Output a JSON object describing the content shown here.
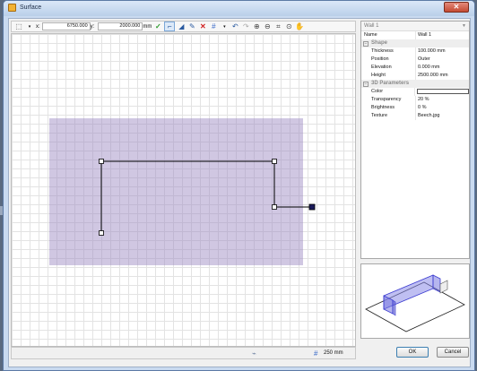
{
  "window": {
    "title": "Surface",
    "close_label": "✕"
  },
  "toolbar": {
    "x_label": "x:",
    "x_value": "6750.000",
    "y_label": "y:",
    "y_value": "2000.000",
    "unit": "mm",
    "icons": [
      "select-tool-icon",
      "dropdown-arrow-icon",
      "checkmark-icon",
      "draw-wall-icon",
      "paint-icon",
      "pen-icon",
      "delete-icon",
      "grid-icon",
      "undo-icon",
      "redo-icon",
      "zoom-in-icon",
      "zoom-out-icon",
      "zoom-fit-icon",
      "zoom-window-icon",
      "pan-hand-icon"
    ]
  },
  "properties": {
    "header": "Wall 1",
    "rows_top": [
      {
        "key": "Name",
        "value": "Wall 1"
      }
    ],
    "shape_label": "Shape",
    "shape": [
      {
        "key": "Thickness",
        "value": "100.000 mm"
      },
      {
        "key": "Position",
        "value": "Outer"
      },
      {
        "key": "Elevation",
        "value": "0.000 mm"
      },
      {
        "key": "Height",
        "value": "2500.000 mm"
      }
    ],
    "params_label": "3D Parameters",
    "params": [
      {
        "key": "Color",
        "value": ""
      },
      {
        "key": "Transparency",
        "value": "20 %"
      },
      {
        "key": "Brightness",
        "value": "0 %"
      },
      {
        "key": "Texture",
        "value": "Beech.jpg"
      }
    ],
    "color_value": "#ffffff"
  },
  "statusbar": {
    "grid_size": "250 mm"
  },
  "buttons": {
    "ok": "OK",
    "cancel": "Cancel"
  },
  "colors": {
    "surface": "#9682be",
    "wall_line": "#000000",
    "accent": "#3c7fb1",
    "preview_wall": "#6a6ae0"
  }
}
